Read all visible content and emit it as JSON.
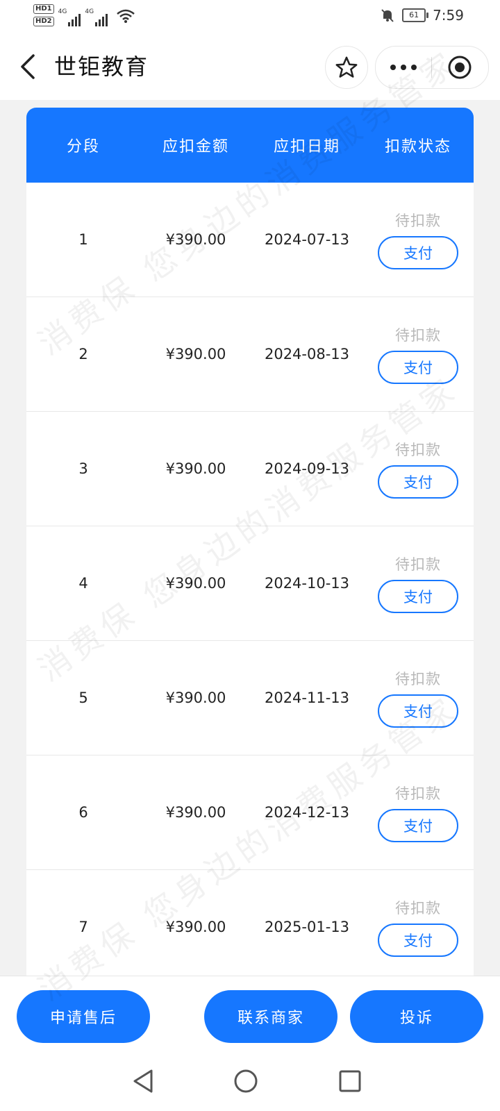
{
  "status_bar": {
    "time": "7:59",
    "battery": "61",
    "network": "4G",
    "hd_badges": [
      "HD1",
      "HD2"
    ]
  },
  "header": {
    "title": "世钜教育"
  },
  "table": {
    "headers": [
      "分段",
      "应扣金额",
      "应扣日期",
      "扣款状态"
    ],
    "rows": [
      {
        "segment": "1",
        "amount": "¥390.00",
        "date": "2024-07-13",
        "status": "待扣款",
        "action": "支付"
      },
      {
        "segment": "2",
        "amount": "¥390.00",
        "date": "2024-08-13",
        "status": "待扣款",
        "action": "支付"
      },
      {
        "segment": "3",
        "amount": "¥390.00",
        "date": "2024-09-13",
        "status": "待扣款",
        "action": "支付"
      },
      {
        "segment": "4",
        "amount": "¥390.00",
        "date": "2024-10-13",
        "status": "待扣款",
        "action": "支付"
      },
      {
        "segment": "5",
        "amount": "¥390.00",
        "date": "2024-11-13",
        "status": "待扣款",
        "action": "支付"
      },
      {
        "segment": "6",
        "amount": "¥390.00",
        "date": "2024-12-13",
        "status": "待扣款",
        "action": "支付"
      },
      {
        "segment": "7",
        "amount": "¥390.00",
        "date": "2025-01-13",
        "status": "待扣款",
        "action": "支付"
      }
    ]
  },
  "actions": {
    "after_sale": "申请售后",
    "contact": "联系商家",
    "complain": "投诉"
  },
  "watermark": "消费保 您身边的消费服务管家",
  "colors": {
    "accent": "#1677ff",
    "status_pending": "#b8b8b8"
  }
}
